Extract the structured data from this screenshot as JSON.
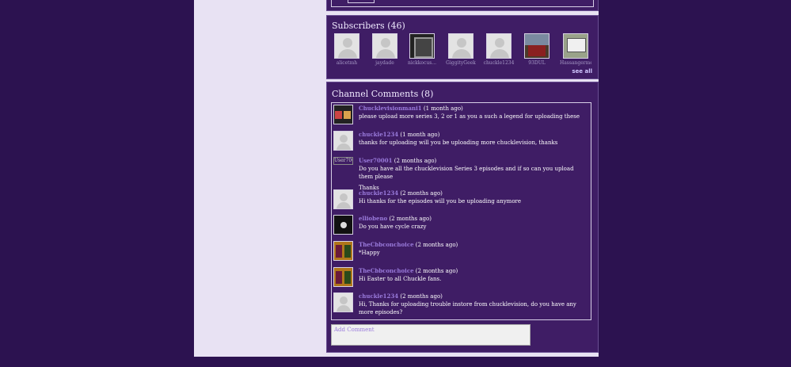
{
  "subscribers": {
    "heading": "Subscribers (46)",
    "see_all": "see all",
    "items": [
      {
        "name": "alicetmh",
        "avatar": "default-avatar"
      },
      {
        "name": "jaydade",
        "avatar": "default-avatar"
      },
      {
        "name": "nickkocus...",
        "avatar": "dark-thumbnail"
      },
      {
        "name": "GiggityGeek",
        "avatar": "default-avatar"
      },
      {
        "name": "chuckle1234",
        "avatar": "default-avatar"
      },
      {
        "name": "93DUL",
        "avatar": "photo-thumbnail"
      },
      {
        "name": "Hassangermei",
        "avatar": "sign-thumbnail"
      }
    ]
  },
  "comments": {
    "heading": "Channel Comments (8)",
    "items": [
      {
        "author": "Chucklevisionmani1",
        "time": "(1 month ago)",
        "text": "please upload more series 3, 2 or 1 as you a such a legend for uploading these",
        "extra": "",
        "avatar": "chucklevision-thumbnail"
      },
      {
        "author": "chuckle1234",
        "time": "(1 month ago)",
        "text": "thanks for uploading will you be uploading more chucklevision, thanks",
        "extra": "",
        "avatar": "default-avatar"
      },
      {
        "author": "User70001",
        "time": "(2 months ago)",
        "text": "Do you have all the chucklevision Series 3 episodes and if so can you upload them please",
        "extra": "Thanks",
        "avatar": "broken-image",
        "avatar_alt": "User70001"
      },
      {
        "author": "chuckle1234",
        "time": "(2 months ago)",
        "text": "Hi thanks for the episodes will you be uploading anymore",
        "extra": "",
        "avatar": "default-avatar"
      },
      {
        "author": "elliobeno",
        "time": "(2 months ago)",
        "text": "Do you have cycle crazy",
        "extra": "",
        "avatar": "cycle-thumbnail"
      },
      {
        "author": "TheCbbconchoice",
        "time": "(2 months ago)",
        "text": "*Happy",
        "extra": "",
        "avatar": "cbbc-thumbnail"
      },
      {
        "author": "TheCbbconchoice",
        "time": "(2 months ago)",
        "text": "Hi Easter to all Chuckle fans.",
        "extra": "",
        "avatar": "cbbc-thumbnail"
      },
      {
        "author": "chuckle1234",
        "time": "(2 months ago)",
        "text": "Hi, Thanks for uploading trouble instore from chucklevision, do you have any more episodes?",
        "extra": "",
        "avatar": "default-avatar"
      }
    ],
    "add_placeholder": "Add Comment"
  }
}
